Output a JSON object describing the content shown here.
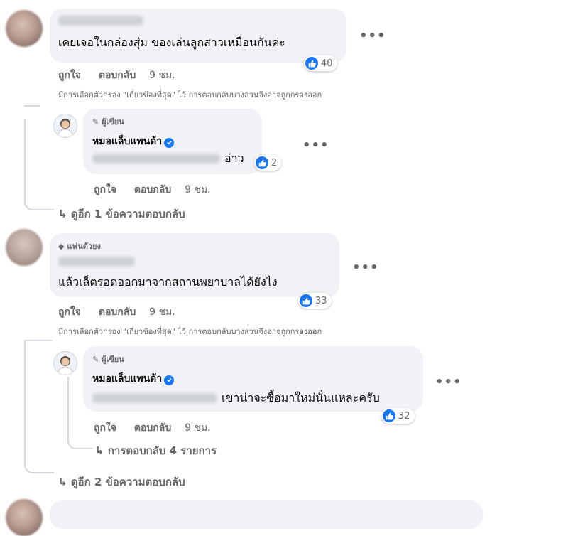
{
  "colors": {
    "accent": "#1877f2",
    "bubble": "#f0f2f5",
    "muted": "#65676b"
  },
  "comments": [
    {
      "author_blurred": true,
      "text": "เคยเจอในกล่องสุ่ม ของเล่นลูกสาวเหมือนกันค่ะ",
      "reactions": "40",
      "actions": {
        "like": "ถูกใจ",
        "reply": "ตอบกลับ",
        "time": "9 ชม."
      },
      "filter_note": "มีการเลือกตัวกรอง \"เกี่ยวข้องที่สุด\" ไว้ การตอบกลับบางส่วนจึงอาจถูกกรองออก",
      "reply": {
        "badge": "ผู้เขียน",
        "author": "หมอแล็บแพนด้า",
        "text": "อ่าว",
        "reactions": "2",
        "actions": {
          "like": "ถูกใจ",
          "reply": "ตอบกลับ",
          "time": "9 ชม."
        }
      },
      "view_more": "ดูอีก 1 ข้อความตอบกลับ"
    },
    {
      "badge": "แฟนตัวยง",
      "author_blurred": true,
      "text": "แล้วเล็ตรอดออกมาจากสถานพยาบาลได้ยังไง",
      "reactions": "33",
      "actions": {
        "like": "ถูกใจ",
        "reply": "ตอบกลับ",
        "time": "9 ชม."
      },
      "filter_note": "มีการเลือกตัวกรอง \"เกี่ยวข้องที่สุด\" ไว้ การตอบกลับบางส่วนจึงอาจถูกกรองออก",
      "reply": {
        "badge": "ผู้เขียน",
        "author": "หมอแล็บแพนด้า",
        "text": "เขาน่าจะซื้อมาใหม่นั่นแหละครับ",
        "reactions": "32",
        "actions": {
          "like": "ถูกใจ",
          "reply": "ตอบกลับ",
          "time": "9 ชม."
        },
        "sub_replies": "การตอบกลับ 4 รายการ"
      },
      "view_more": "ดูอีก 2 ข้อความตอบกลับ"
    }
  ],
  "icons": {
    "like": "thumbs-up-icon",
    "more": "more-options-icon",
    "reply_arrow": "reply-arrow-icon",
    "pencil": "pencil-icon",
    "diamond": "diamond-icon",
    "verified": "verified-badge-icon"
  }
}
